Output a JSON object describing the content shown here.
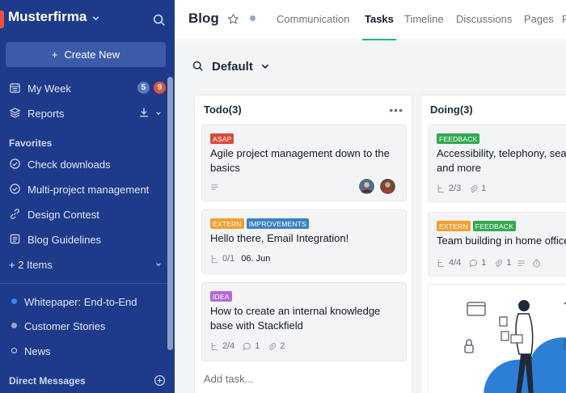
{
  "workspace": {
    "name": "Musterfirma"
  },
  "sidebar": {
    "create_label": "Create New",
    "my_week": {
      "label": "My Week",
      "badge_blue": "5",
      "badge_red": "9"
    },
    "reports": {
      "label": "Reports"
    },
    "favorites_title": "Favorites",
    "favorites": [
      {
        "label": "Check downloads"
      },
      {
        "label": "Multi-project management"
      },
      {
        "label": "Design Contest"
      },
      {
        "label": "Blog Guidelines"
      }
    ],
    "more_items": "+ 2 Items",
    "projects": [
      {
        "label": "Whitepaper: End-to-End",
        "color": "#3b82f6"
      },
      {
        "label": "Customer Stories",
        "color": "#9aa6c8"
      },
      {
        "label": "News",
        "color": "transparent"
      }
    ],
    "direct_messages": "Direct Messages"
  },
  "header": {
    "title": "Blog",
    "tabs": [
      {
        "label": "Communication",
        "active": false
      },
      {
        "label": "Tasks",
        "active": true
      },
      {
        "label": "Timeline",
        "active": false
      },
      {
        "label": "Discussions",
        "active": false
      },
      {
        "label": "Pages",
        "active": false
      },
      {
        "label": "F",
        "active": false
      }
    ]
  },
  "board": {
    "view_name": "Default",
    "columns": [
      {
        "title": "Todo(3)",
        "add_task": "Add task...",
        "cards": [
          {
            "tags": [
              {
                "label": "ASAP",
                "color": "#d84a3a"
              }
            ],
            "title": "Agile project management down to the basics"
          },
          {
            "tags": [
              {
                "label": "EXTERN",
                "color": "#f0a030"
              },
              {
                "label": "IMPROVEMENTS",
                "color": "#3b82c4"
              }
            ],
            "title": "Hello there, Email Integration!",
            "subtasks": "0/1",
            "date": "06. Jun"
          },
          {
            "tags": [
              {
                "label": "IDEA",
                "color": "#b46ad6"
              }
            ],
            "title": "How to create an internal knowledge base with Stackfield",
            "subtasks": "2/4",
            "comments": "1",
            "attachments": "2"
          }
        ]
      },
      {
        "title": "Doing(3)",
        "cards": [
          {
            "tags": [
              {
                "label": "FEEDBACK",
                "color": "#34a853"
              }
            ],
            "title": "Accessibility, telephony, search engines and more",
            "subtasks": "2/3",
            "attachments": "1"
          },
          {
            "tags": [
              {
                "label": "EXTERN",
                "color": "#f0a030"
              },
              {
                "label": "FEEDBACK",
                "color": "#34a853"
              }
            ],
            "title": "Team building in home office",
            "subtasks": "4/4",
            "comments": "1",
            "attachments": "1"
          }
        ]
      }
    ]
  },
  "colors": {
    "sidebar": "#1e3a8a",
    "accent": "#10b981",
    "badge_blue": "#5a78c4",
    "badge_red": "#e0533f"
  }
}
